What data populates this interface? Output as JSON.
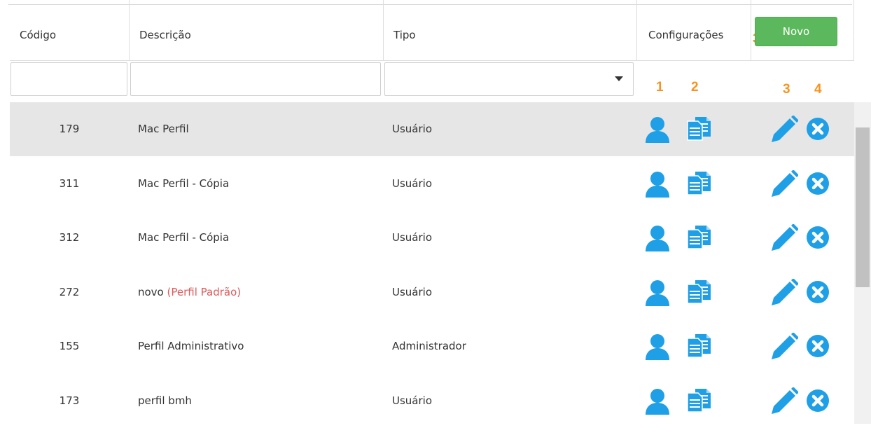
{
  "columns": {
    "code": "Código",
    "description": "Descrição",
    "type": "Tipo",
    "settings": "Configurações"
  },
  "new_button_label": "Novo",
  "markers": {
    "new_button": "3",
    "profile": "1",
    "copy": "2",
    "edit": "3",
    "delete": "4"
  },
  "rows": [
    {
      "code": "179",
      "description": "Mac Perfil",
      "default_tag": "",
      "type": "Usuário",
      "selected": true
    },
    {
      "code": "311",
      "description": "Mac Perfil - Cópia",
      "default_tag": "",
      "type": "Usuário",
      "selected": false
    },
    {
      "code": "312",
      "description": "Mac Perfil - Cópia",
      "default_tag": "",
      "type": "Usuário",
      "selected": false
    },
    {
      "code": "272",
      "description": "novo",
      "default_tag": "(Perfil Padrão)",
      "type": "Usuário",
      "selected": false
    },
    {
      "code": "155",
      "description": "Perfil Administrativo",
      "default_tag": "",
      "type": "Administrador",
      "selected": false
    },
    {
      "code": "173",
      "description": "perfil bmh",
      "default_tag": "",
      "type": "Usuário",
      "selected": false
    }
  ],
  "icons": {
    "profile": "user-icon",
    "copy": "copy-icon",
    "edit": "pencil-icon",
    "delete": "close-circle-icon",
    "select": "chevron-down-icon"
  },
  "colors": {
    "icon_blue": "#1e9fe6",
    "marker_orange": "#f7931e",
    "button_green": "#5cb85c",
    "default_tag_red": "#e05a5a",
    "selected_row": "#e6e6e6"
  }
}
